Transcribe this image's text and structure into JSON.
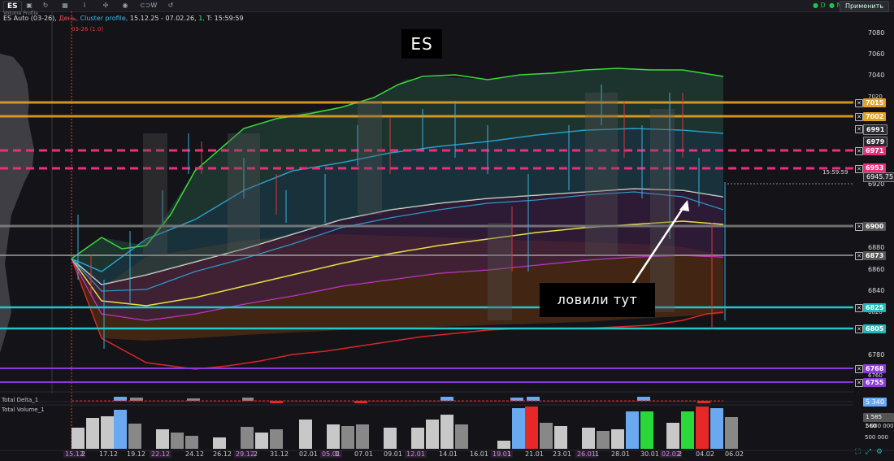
{
  "toolbar": {
    "symbol": "ES",
    "buttons": [
      "file-icon",
      "refresh-icon",
      "calendar-icon",
      "chart-type-icon",
      "crosshair-icon",
      "eye-icon",
      "link-icon",
      "undo-icon"
    ],
    "link_label": "W",
    "badge_d": "D",
    "badge_n": "N",
    "apply_label": "Применить"
  },
  "header": {
    "symbol_line": "ES Auto (03-26),",
    "period": "День,",
    "profile": "Cluster profile,",
    "range": "15.12.25 - 07.02.26,",
    "one": "1,",
    "time": "T: 15:59:59",
    "sub_label": "03-26 (1.0)",
    "vp_label": "Volume Profile"
  },
  "chart_title": "ES",
  "callout_text": "ловили тут",
  "time_label": "15:59:59",
  "current_price": "6945.75",
  "price_axis": [
    "7080",
    "7060",
    "7040",
    "7020",
    "6940",
    "6920",
    "6880",
    "6860",
    "6840",
    "6820",
    "6780",
    "6760"
  ],
  "levels": [
    {
      "price": "7015",
      "color": "#e8a020"
    },
    {
      "price": "7002",
      "color": "#e8a020"
    },
    {
      "price": "6991",
      "color": "#333"
    },
    {
      "price": "6979",
      "color": "#333"
    },
    {
      "price": "6971",
      "color": "#e8307a"
    },
    {
      "price": "6953",
      "color": "#e8307a"
    },
    {
      "price": "6900",
      "color": "#666"
    },
    {
      "price": "6873",
      "color": "#666"
    },
    {
      "price": "6825",
      "color": "#20c8c8"
    },
    {
      "price": "6805",
      "color": "#20c8c8"
    },
    {
      "price": "6768",
      "color": "#8a3ad8"
    },
    {
      "price": "6755",
      "color": "#8a3ad8"
    }
  ],
  "panels": {
    "delta_label": "Total Delta_1",
    "delta_value": "5 340",
    "volume_label": "Total Volume_1",
    "volume_value": "1 585 560",
    "vol_axis": [
      "1 000 000",
      "500 000"
    ]
  },
  "x_axis": [
    {
      "label": "15.12",
      "hl": true
    },
    {
      "label": "2",
      "hl": false
    },
    {
      "label": "17.12",
      "hl": false
    },
    {
      "label": "19.12",
      "hl": false
    },
    {
      "label": "22.12",
      "hl": true
    },
    {
      "label": "24.12",
      "hl": false
    },
    {
      "label": "26.12",
      "hl": false
    },
    {
      "label": "29.12",
      "hl": true
    },
    {
      "label": "2",
      "hl": false
    },
    {
      "label": "31.12",
      "hl": false
    },
    {
      "label": "02.01",
      "hl": false
    },
    {
      "label": "05.01",
      "hl": true
    },
    {
      "label": "1",
      "hl": false
    },
    {
      "label": "07.01",
      "hl": false
    },
    {
      "label": "09.01",
      "hl": false
    },
    {
      "label": "12.01",
      "hl": true
    },
    {
      "label": "14.01",
      "hl": false
    },
    {
      "label": "16.01",
      "hl": false
    },
    {
      "label": "19.01",
      "hl": true
    },
    {
      "label": "1",
      "hl": false
    },
    {
      "label": "21.01",
      "hl": false
    },
    {
      "label": "23.01",
      "hl": false
    },
    {
      "label": "26.01",
      "hl": true
    },
    {
      "label": "1",
      "hl": false
    },
    {
      "label": "28.01",
      "hl": false
    },
    {
      "label": "30.01",
      "hl": false
    },
    {
      "label": "02.02",
      "hl": true
    },
    {
      "label": "2",
      "hl": false
    },
    {
      "label": "04.02",
      "hl": false
    },
    {
      "label": "06.02",
      "hl": false
    }
  ],
  "colors": {
    "green_band": "#3ad83a",
    "cyan_band": "#2aaad8",
    "yellow_band": "#e8e040",
    "magenta_band": "#d83ad8",
    "red_band": "#d82828",
    "white_line": "#f0f0d8"
  }
}
